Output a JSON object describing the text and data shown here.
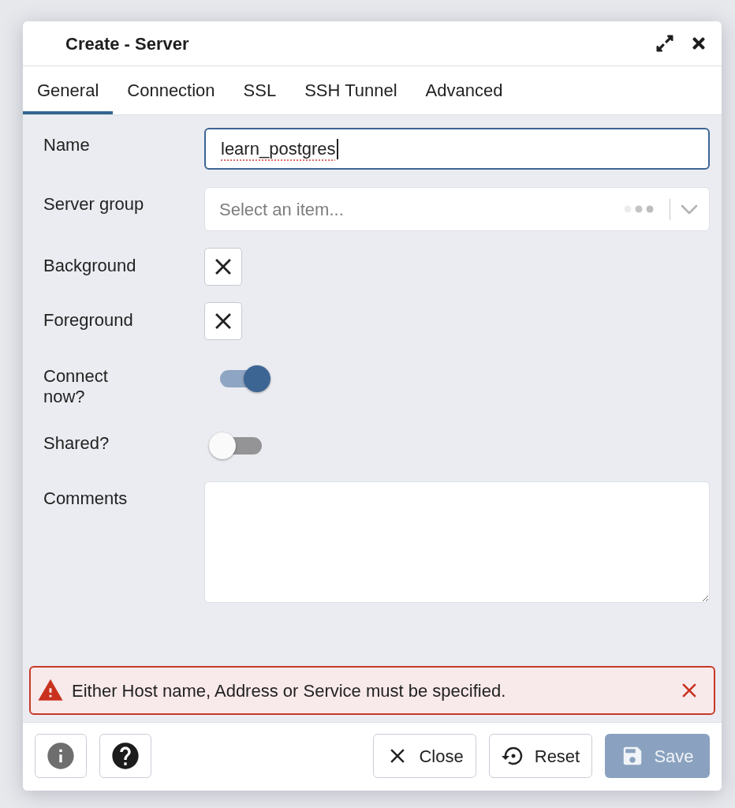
{
  "window": {
    "title": "Create - Server"
  },
  "tabs": [
    {
      "label": "General",
      "selected": true
    },
    {
      "label": "Connection",
      "selected": false
    },
    {
      "label": "SSL",
      "selected": false
    },
    {
      "label": "SSH Tunnel",
      "selected": false
    },
    {
      "label": "Advanced",
      "selected": false
    }
  ],
  "form": {
    "fields": [
      {
        "kind": "text",
        "label": "Name",
        "value": "learn_postgres",
        "focused": true,
        "misspelled": true
      },
      {
        "kind": "select",
        "label": "Server group",
        "placeholder": "Select an item...",
        "focused": false
      },
      {
        "kind": "color",
        "label": "Background"
      },
      {
        "kind": "color",
        "label": "Foreground"
      },
      {
        "kind": "switch",
        "label": "Connect now?",
        "on": true
      },
      {
        "kind": "switch",
        "label": "Shared?",
        "on": false
      },
      {
        "kind": "textarea",
        "label": "Comments",
        "focused": false
      }
    ]
  },
  "alert": {
    "message": "Either Host name, Address or Service must be specified."
  },
  "footer": {
    "buttons": [
      {
        "kind": "info",
        "disabled": true
      },
      {
        "kind": "help",
        "disabled": false
      },
      {
        "kind": "close",
        "label": "Close",
        "disabled": false
      },
      {
        "kind": "reset",
        "label": "Reset",
        "disabled": false
      },
      {
        "kind": "save",
        "label": "Save",
        "disabled": true
      }
    ]
  }
}
